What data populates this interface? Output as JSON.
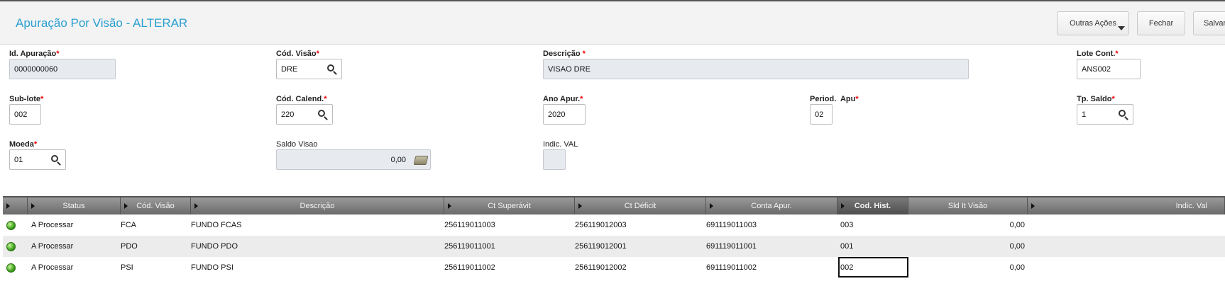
{
  "header": {
    "title": "Apuração Por Visão - ALTERAR",
    "buttons": {
      "other_actions": "Outras Ações",
      "close": "Fechar",
      "save": "Salvar"
    }
  },
  "form": {
    "id_apuracao": {
      "label": "Id. Apuração",
      "value": "0000000060"
    },
    "cod_visao": {
      "label": "Cód. Visão",
      "value": "DRE"
    },
    "descricao": {
      "label": "Descrição",
      "value": "VISAO DRE"
    },
    "lote_cont": {
      "label": "Lote Cont.",
      "value": "ANS002"
    },
    "sub_lote": {
      "label": "Sub-lote",
      "value": "002"
    },
    "cod_calend": {
      "label": "Cód. Calend.",
      "value": "220"
    },
    "ano_apur": {
      "label": "Ano Apur.",
      "value": "2020"
    },
    "period_apu": {
      "label": "Period.  Apu",
      "value": "02"
    },
    "tp_saldo": {
      "label": "Tp. Saldo",
      "value": "1"
    },
    "moeda": {
      "label": "Moeda",
      "value": "01"
    },
    "saldo_visao": {
      "label": "Saldo Visao",
      "value": "0,00"
    },
    "indic_val": {
      "label": "Indic. VAL",
      "value": ""
    },
    "required_mark": "*"
  },
  "grid": {
    "columns": [
      "Status",
      "Cód. Visão",
      "Descrição",
      "Ct Superávit",
      "Ct Déficit",
      "Conta Apur.",
      "Cod. Hist.",
      "Sld It Visão",
      "Indic. Val"
    ],
    "rows": [
      {
        "status": "A Processar",
        "cod_visao": "FCA",
        "descricao": "FUNDO FCAS",
        "ct_superavit": "256119011003",
        "ct_deficit": "256119012003",
        "conta_apur": "691119011003",
        "cod_hist": "003",
        "sld": "0,00"
      },
      {
        "status": "A Processar",
        "cod_visao": "PDO",
        "descricao": "FUNDO PDO",
        "ct_superavit": "256119011001",
        "ct_deficit": "256119012001",
        "conta_apur": "691119011001",
        "cod_hist": "001",
        "sld": "0,00"
      },
      {
        "status": "A Processar",
        "cod_visao": "PSI",
        "descricao": "FUNDO PSI",
        "ct_superavit": "256119011002",
        "ct_deficit": "256119012002",
        "conta_apur": "691119011002",
        "cod_hist": "002",
        "sld": "0,00"
      }
    ]
  },
  "colors": {
    "title": "#2a9fd0",
    "required": "#e00000",
    "status_ok": "#3aa11a",
    "grid_header": "#7a7a7a",
    "row_alt": "#ececec"
  }
}
